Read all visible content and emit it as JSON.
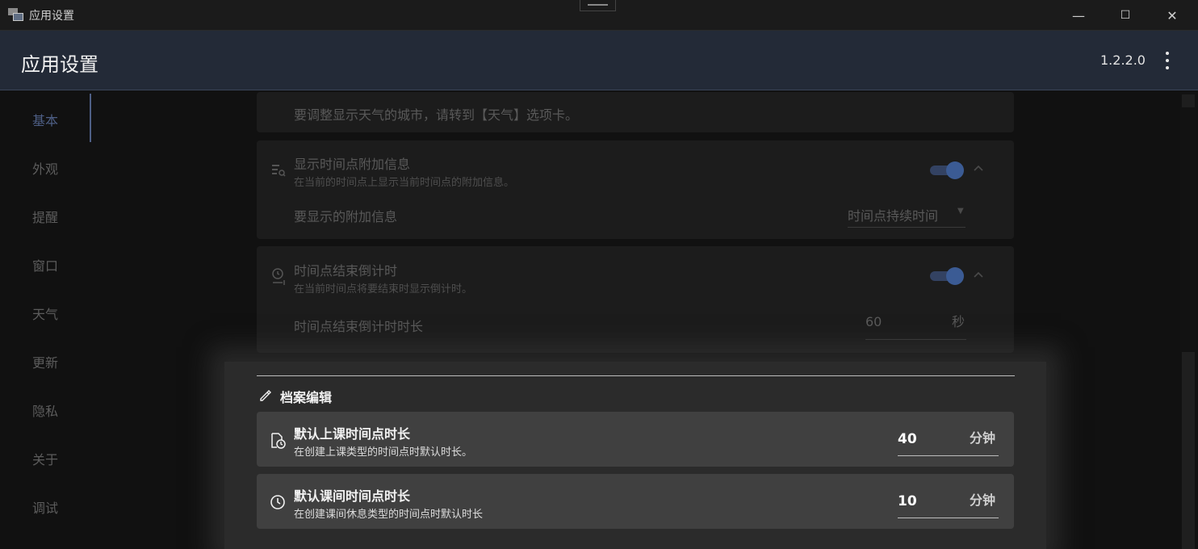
{
  "window": {
    "title": "应用设置",
    "minimize": "—",
    "maximize": "☐",
    "close": "✕"
  },
  "header": {
    "title": "应用设置",
    "version": "1.2.2.0"
  },
  "sidebar": {
    "items": [
      {
        "label": "基本",
        "active": true
      },
      {
        "label": "外观"
      },
      {
        "label": "提醒"
      },
      {
        "label": "窗口"
      },
      {
        "label": "天气"
      },
      {
        "label": "更新"
      },
      {
        "label": "隐私"
      },
      {
        "label": "关于"
      },
      {
        "label": "调试"
      }
    ]
  },
  "content": {
    "weather_note": "要调整显示天气的城市，请转到【天气】选项卡。",
    "extra_info": {
      "title": "显示时间点附加信息",
      "desc": "在当前的时间点上显示当前时间点的附加信息。",
      "enabled": true,
      "select_label": "要显示的附加信息",
      "select_value": "时间点持续时间"
    },
    "countdown": {
      "title": "时间点结束倒计时",
      "desc": "在当前时间点将要结束时显示倒计时。",
      "enabled": true,
      "duration_label": "时间点结束倒计时时长",
      "duration_value": "60",
      "duration_unit": "秒"
    },
    "profile_edit": {
      "section_title": "档案编辑",
      "class_duration": {
        "title": "默认上课时间点时长",
        "desc": "在创建上课类型的时间点时默认时长。",
        "value": "40",
        "unit": "分钟"
      },
      "break_duration": {
        "title": "默认课间时间点时长",
        "desc": "在创建课间休息类型的时间点时默认时长",
        "value": "10",
        "unit": "分钟"
      }
    }
  },
  "colors": {
    "accent": "#4e5f86",
    "header_bg": "#232a37",
    "toggle_on": "#3b5b94"
  }
}
